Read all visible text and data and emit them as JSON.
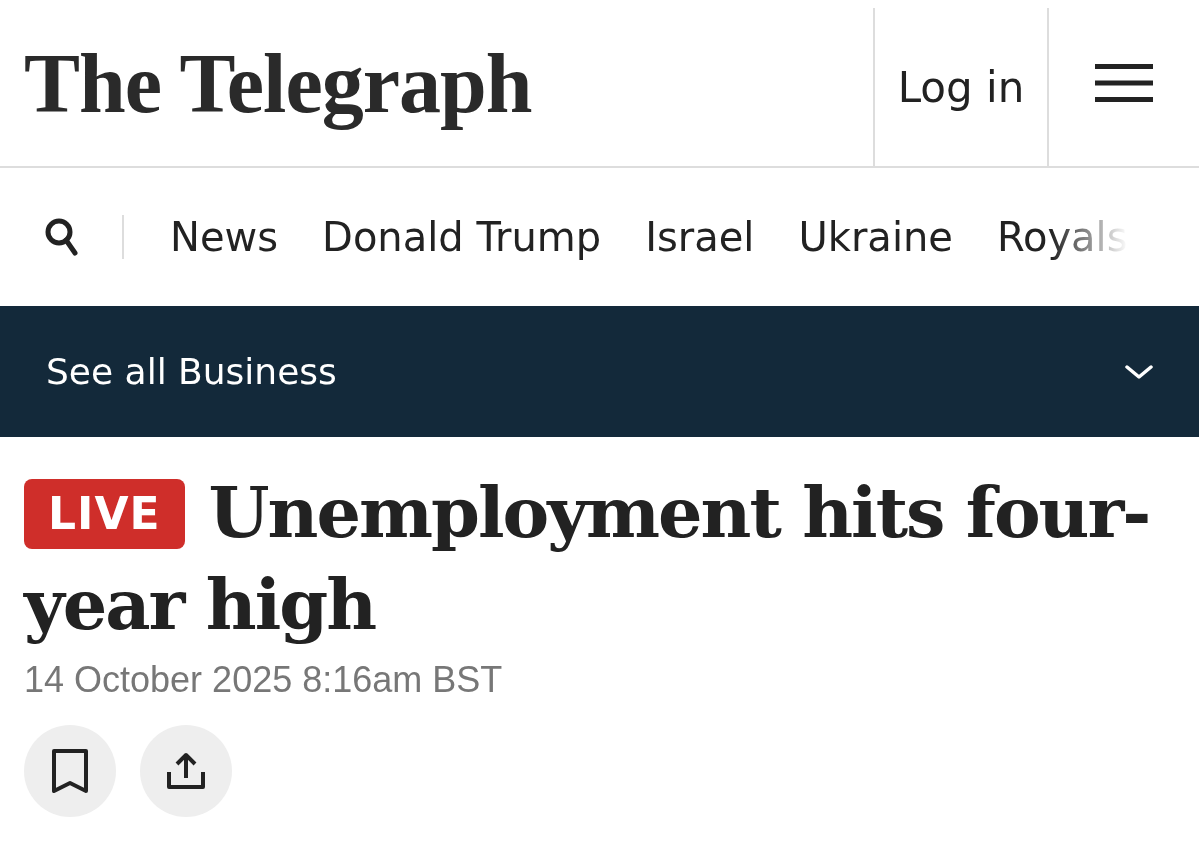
{
  "header": {
    "logo": "The Telegraph",
    "login": "Log in"
  },
  "nav": {
    "items": [
      "News",
      "Donald Trump",
      "Israel",
      "Ukraine",
      "Royals"
    ]
  },
  "section_bar": {
    "label": "See all Business"
  },
  "article": {
    "badge": "LIVE",
    "headline": "Unemployment hits four-year high",
    "date": "14 October 2025 8:16am BST"
  }
}
